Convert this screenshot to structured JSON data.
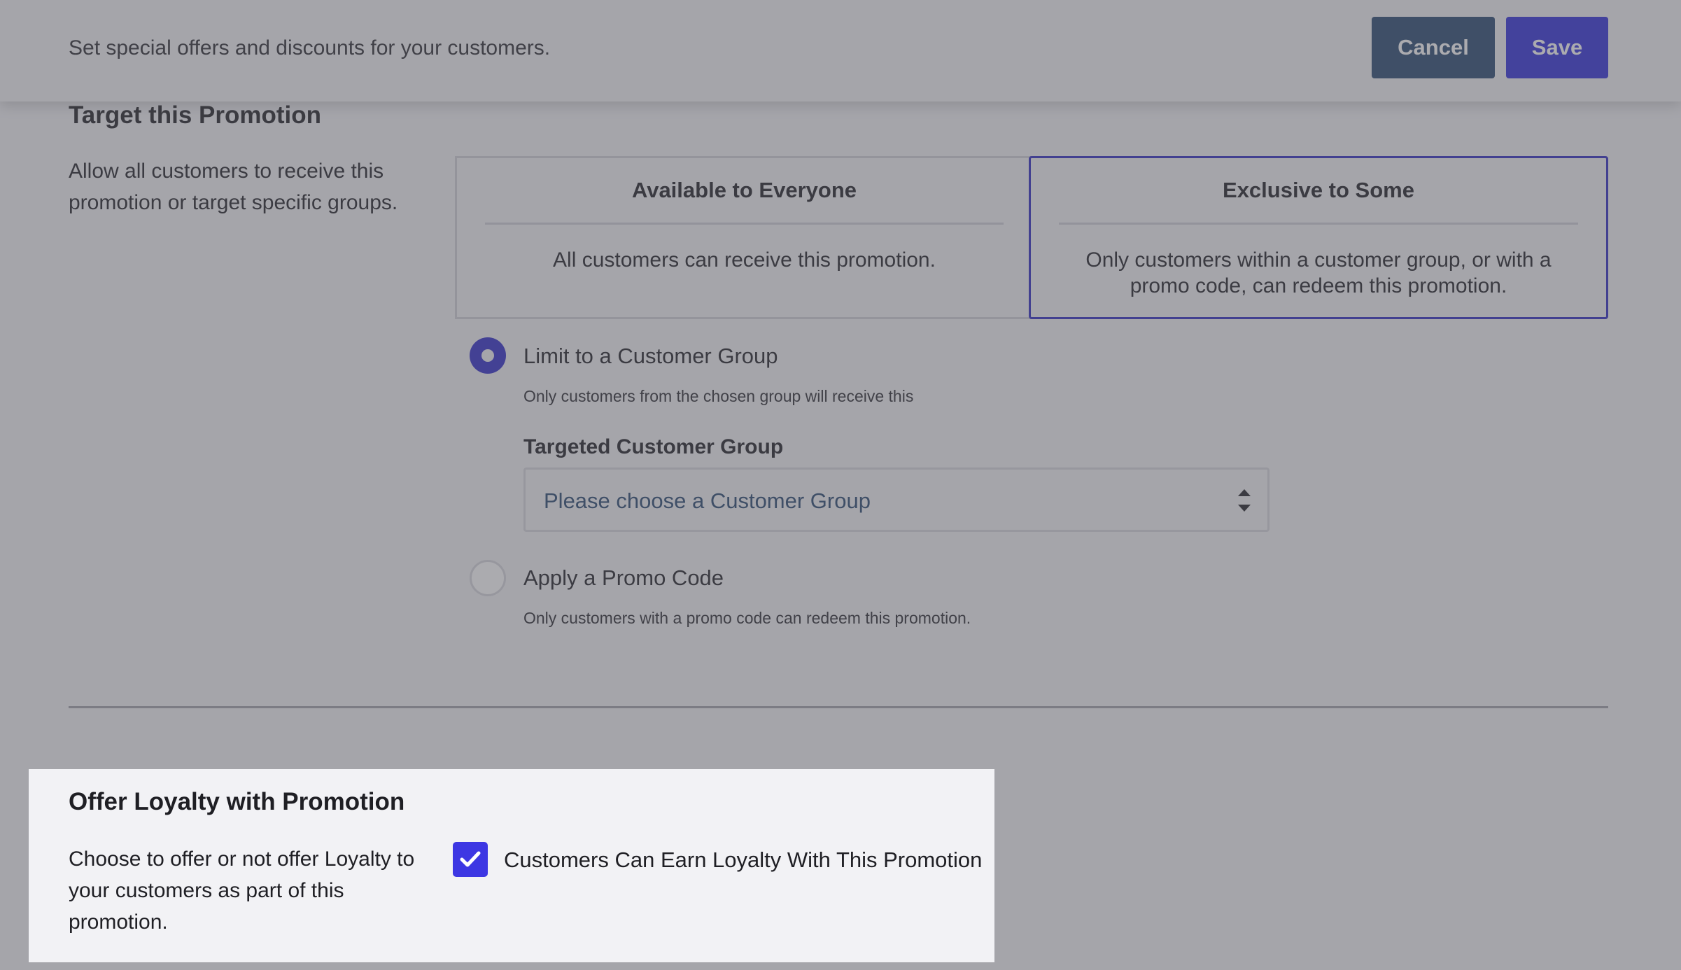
{
  "header": {
    "subtitle": "Set special offers and discounts for your customers.",
    "cancel_label": "Cancel",
    "save_label": "Save"
  },
  "target": {
    "title": "Target this Promotion",
    "description": "Allow all customers to receive this promotion or target specific groups.",
    "cards": [
      {
        "title": "Available to Everyone",
        "text": "All customers can receive this promotion.",
        "selected": false
      },
      {
        "title": "Exclusive to Some",
        "text": "Only customers within a customer group, or with a promo code, can redeem this promotion.",
        "selected": true
      }
    ],
    "options": [
      {
        "label": "Limit to a Customer Group",
        "help": "Only customers from the chosen group will receive this",
        "selected": true
      },
      {
        "label": "Apply a Promo Code",
        "help": "Only customers with a promo code can redeem this promotion.",
        "selected": false
      }
    ],
    "group_field": {
      "label": "Targeted Customer Group",
      "value": "Please choose a Customer Group"
    }
  },
  "loyalty": {
    "title": "Offer Loyalty with Promotion",
    "description": "Choose to offer or not offer Loyalty to your customers as part of this promotion.",
    "checkbox_label": "Customers Can Earn Loyalty With This Promotion",
    "checked": true
  },
  "colors": {
    "primary": "#2e2cd8",
    "cancel": "#27466f",
    "checkbox": "#3d37e3",
    "overlay": "rgba(88,88,96,0.5)"
  },
  "icons": {
    "select_arrows": "sort-arrows-icon",
    "checkbox": "checkmark-icon"
  }
}
